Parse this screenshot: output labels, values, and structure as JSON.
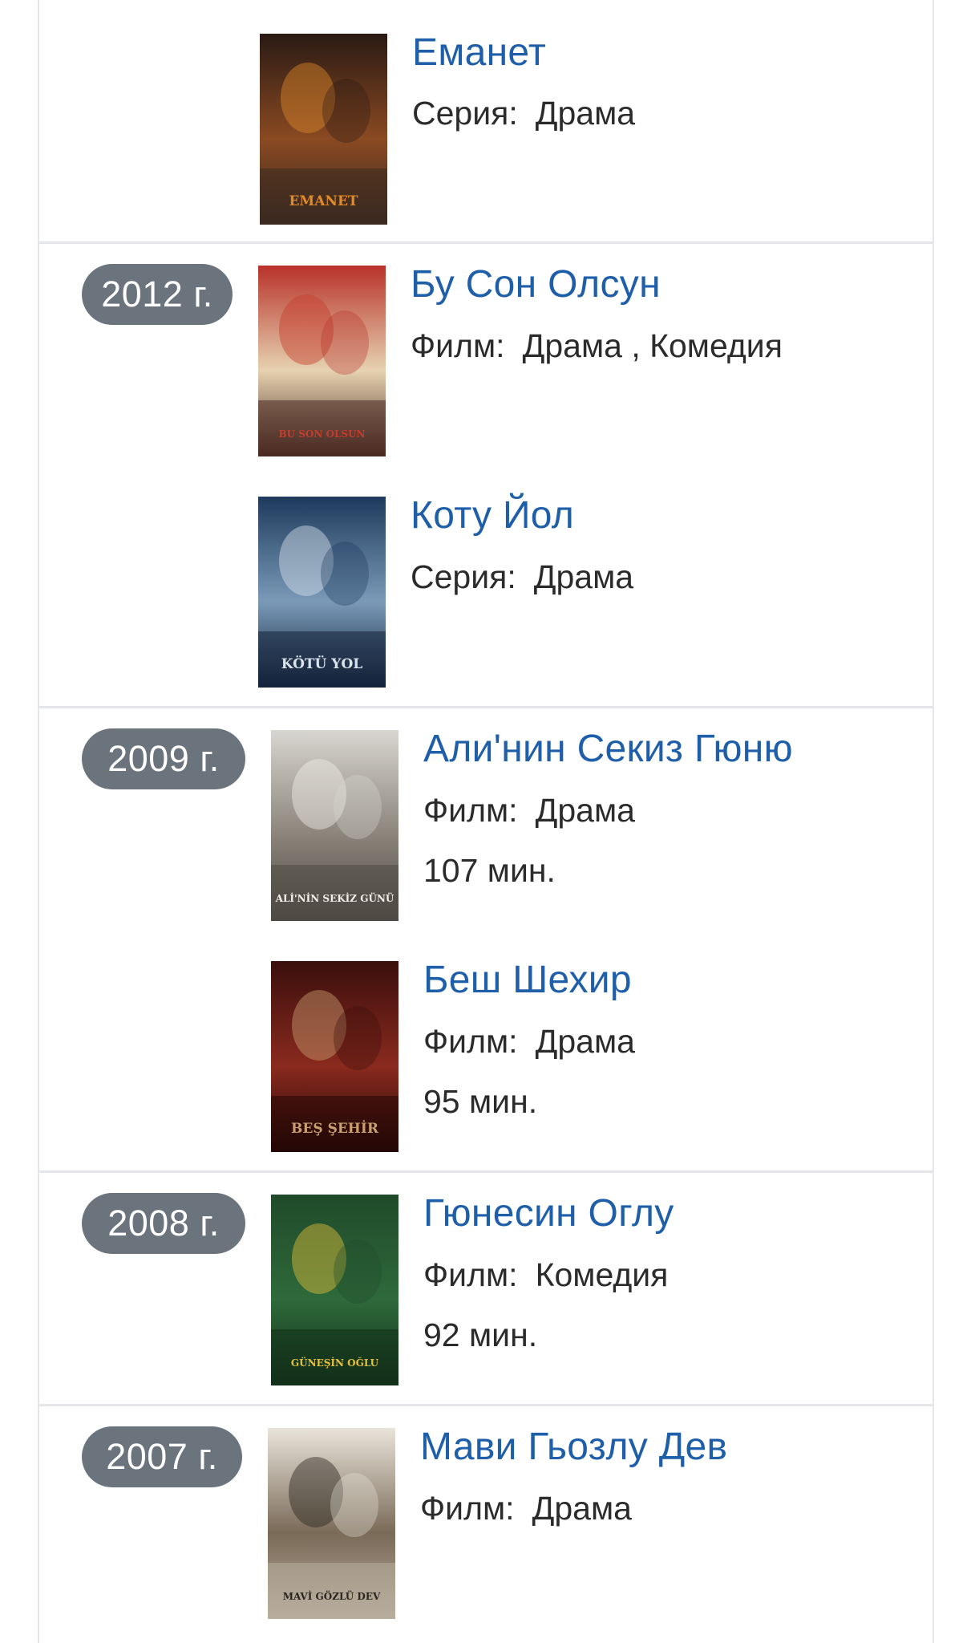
{
  "entries": [
    {
      "title": "Еманет",
      "type": "Серия:",
      "genre": "Драма",
      "poster_text": "EMANET",
      "poster_colors": [
        "#2a1a14",
        "#8a4a22",
        "#e08a2a",
        "#3a2a20"
      ]
    },
    {
      "year": "2012 г.",
      "title": "Бу Сон Олсун",
      "type": "Филм:",
      "genre": "Драма , Комедия",
      "poster_text": "BU SON OLSUN",
      "poster_colors": [
        "#b8322a",
        "#e6d2b0",
        "#c53c2c",
        "#4a2a22"
      ]
    },
    {
      "title": "Коту Йол",
      "type": "Серия:",
      "genre": "Драма",
      "poster_text": "KÖTÜ YOL",
      "poster_colors": [
        "#1e3a5c",
        "#7a9ab8",
        "#d9e3ec",
        "#14233a"
      ]
    },
    {
      "year": "2009 г.",
      "title": "Али'нин Секиз Гюню",
      "type": "Филм:",
      "genre": "Драма",
      "duration": "107 мин.",
      "poster_text": "ALİ'NİN SEKİZ GÜNÜ",
      "poster_colors": [
        "#d8d6d0",
        "#8a847a",
        "#f1efe9",
        "#4e4a44"
      ]
    },
    {
      "title": "Беш Шехир",
      "type": "Филм:",
      "genre": "Драма",
      "duration": "95 мин.",
      "poster_text": "BEŞ ŞEHİR",
      "poster_colors": [
        "#3a0f0c",
        "#8a2a1e",
        "#c9a070",
        "#240806"
      ]
    },
    {
      "year": "2008 г.",
      "title": "Гюнесин Оглу",
      "type": "Филм:",
      "genre": "Комедия",
      "duration": "92 мин.",
      "poster_text": "GÜNEŞİN OĞLU",
      "poster_colors": [
        "#1f4a2a",
        "#2f6a3a",
        "#e6c23a",
        "#12301a"
      ]
    },
    {
      "year": "2007 г.",
      "title": "Мави Гьозлу Дев",
      "type": "Филм:",
      "genre": "Драма",
      "poster_text": "MAVİ GÖZLÜ DEV",
      "poster_colors": [
        "#e9e4da",
        "#7a6a58",
        "#2b2520",
        "#b8ad9c"
      ]
    }
  ],
  "colors": {
    "title": "#1f5ea8",
    "badge_bg": "#6b737c",
    "badge_text": "#ffffff",
    "separator": "#e4e6e9",
    "meta_text": "#2b2b2b"
  }
}
